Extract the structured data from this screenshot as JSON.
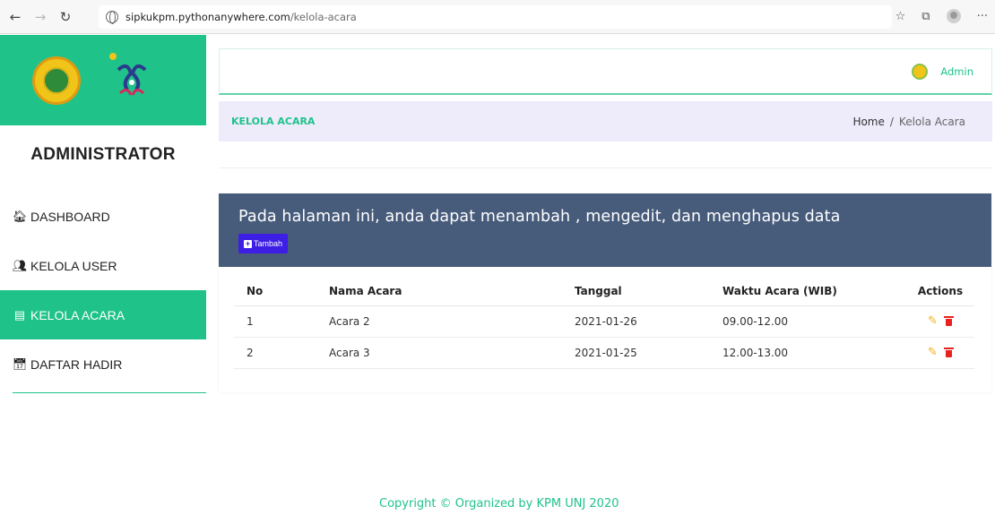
{
  "browser": {
    "url_host": "sipkukpm.pythonanywhere.com",
    "url_path": "/kelola-acara",
    "back_icon": "arrow-left-icon",
    "forward_icon": "arrow-right-icon",
    "reload_icon": "reload-icon",
    "favorites_icon": "favorites-icon",
    "collections_icon": "collections-icon",
    "profile_icon": "profile-icon",
    "more_icon": "more-icon"
  },
  "sidebar": {
    "title": "ADMINISTRATOR",
    "accent_color": "#1fc38a",
    "items": [
      {
        "label": "DASHBOARD",
        "icon": "home-icon",
        "glyph": "🏠︎"
      },
      {
        "label": "KELOLA USER",
        "icon": "users-icon",
        "glyph": "👥︎"
      },
      {
        "label": "KELOLA ACARA",
        "icon": "list-icon",
        "glyph": "▤"
      },
      {
        "label": "DAFTAR HADIR",
        "icon": "calendar-check-icon",
        "glyph": "📅︎"
      }
    ]
  },
  "header": {
    "user_label": "Admin"
  },
  "breadcrumb": {
    "page_title": "KELOLA ACARA",
    "home": "Home",
    "separator": "/",
    "current": "Kelola Acara"
  },
  "card": {
    "headline": "Pada halaman ini, anda dapat menambah , mengedit, dan menghapus data",
    "add_button_label": "Tambah",
    "header_color": "#475b7b",
    "button_color": "#3c1ee5"
  },
  "table": {
    "headers": [
      "No",
      "Nama Acara",
      "Tanggal",
      "Waktu Acara (WIB)",
      "Actions"
    ],
    "rows": [
      {
        "no": "1",
        "name": "Acara 2",
        "date": "2021-01-26",
        "time": "09.00-12.00"
      },
      {
        "no": "2",
        "name": "Acara 3",
        "date": "2021-01-25",
        "time": "12.00-13.00"
      }
    ]
  },
  "footer": {
    "text": "Copyright © Organized by KPM UNJ 2020"
  }
}
